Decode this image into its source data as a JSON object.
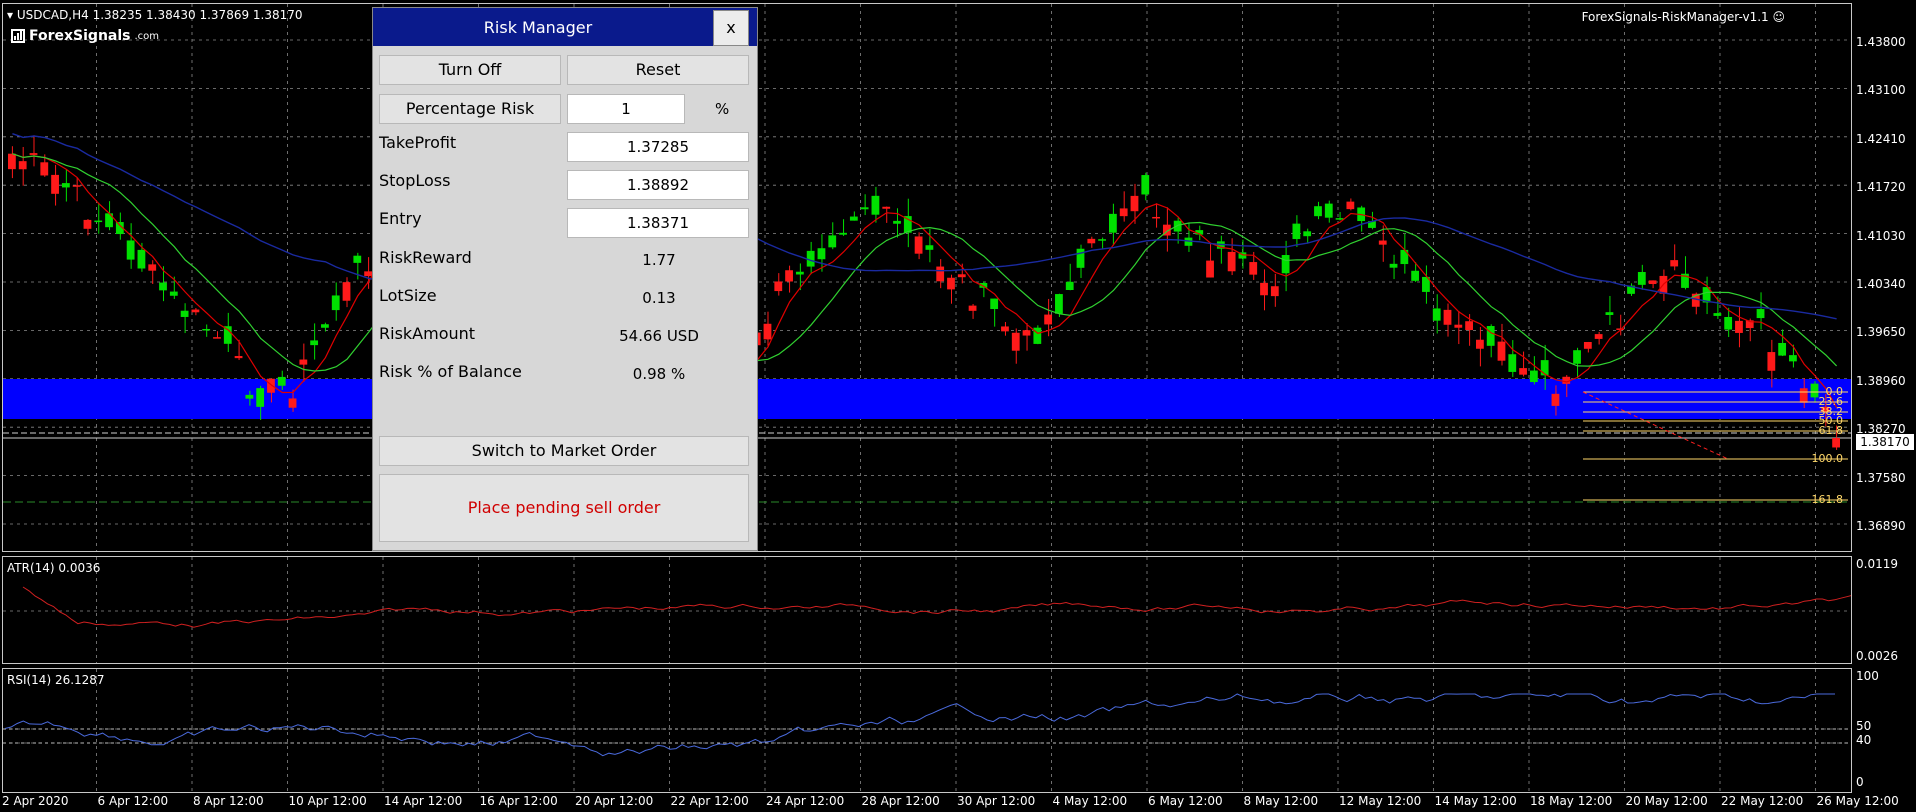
{
  "chart": {
    "symbol_line": "▾ USDCAD,H4  1.38235 1.38430 1.37869 1.38170",
    "brand": "ForexSignals",
    "brand_suffix": ".com",
    "ea_name": "ForexSignals-RiskManager-v1.1 ☺",
    "current_price": "1.38170",
    "price_axis": [
      "1.43800",
      "1.43100",
      "1.42410",
      "1.41720",
      "1.41030",
      "1.40340",
      "1.39650",
      "1.38960",
      "1.38270",
      "1.37580",
      "1.36890"
    ],
    "fib_levels": [
      "0.0",
      "23.6",
      "38.2",
      "50.0",
      "61.8",
      "100.0",
      "161.8"
    ],
    "time_axis": [
      "2 Apr 2020",
      "6 Apr 12:00",
      "8 Apr 12:00",
      "10 Apr 12:00",
      "14 Apr 12:00",
      "16 Apr 12:00",
      "20 Apr 12:00",
      "22 Apr 12:00",
      "24 Apr 12:00",
      "28 Apr 12:00",
      "30 Apr 12:00",
      "4 May 12:00",
      "6 May 12:00",
      "8 May 12:00",
      "12 May 12:00",
      "14 May 12:00",
      "18 May 12:00",
      "20 May 12:00",
      "22 May 12:00",
      "26 May 12:00"
    ],
    "colors": {
      "bull": "#00e000",
      "bear": "#ff1a1a",
      "zone": "#0000ff",
      "ma_fast": "#e00000",
      "ma_mid": "#30d030",
      "ma_slow": "#1a2aa0",
      "atr": "#d02020",
      "rsi": "#4a6adc",
      "fib": "#ffd86a"
    }
  },
  "atr": {
    "title": "ATR(14) 0.0036",
    "axis": [
      "0.0119",
      "0.0026"
    ]
  },
  "rsi": {
    "title": "RSI(14) 26.1287",
    "axis": [
      "100",
      "50",
      "40",
      "0"
    ]
  },
  "risk_manager": {
    "title": "Risk Manager",
    "close_label": "x",
    "turn_off_label": "Turn Off",
    "reset_label": "Reset",
    "mode_label": "Percentage Risk",
    "risk_value": "1",
    "risk_unit": "%",
    "take_profit_label": "TakeProfit",
    "take_profit_value": "1.37285",
    "stop_loss_label": "StopLoss",
    "stop_loss_value": "1.38892",
    "entry_label": "Entry",
    "entry_value": "1.38371",
    "risk_reward_label": "RiskReward",
    "risk_reward_value": "1.77",
    "lot_size_label": "LotSize",
    "lot_size_value": "0.13",
    "risk_amount_label": "RiskAmount",
    "risk_amount_value": "54.66 USD",
    "risk_pct_label": "Risk % of Balance",
    "risk_pct_value": "0.98 %",
    "switch_label": "Switch to Market Order",
    "pending_label": "Place pending sell order"
  }
}
